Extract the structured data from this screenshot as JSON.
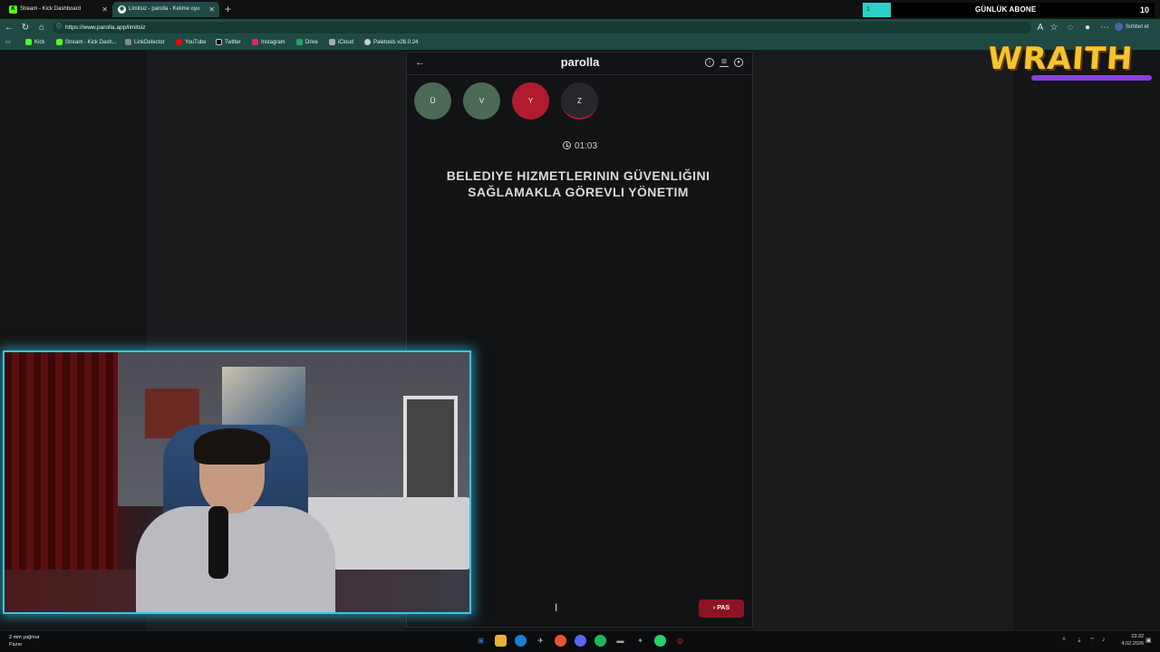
{
  "browser": {
    "tabs": [
      {
        "title": "Stream - Kick Dashboard",
        "favicon": "kick-icon",
        "active": false
      },
      {
        "title": "Limitsiz - parolla - Kelime oyu",
        "favicon": "parolla-icon",
        "active": true
      }
    ],
    "new_tab_label": "+",
    "url": "https://www.parolla.app/limitsiz",
    "chat_label": "Sohbet et",
    "bookmarks": [
      {
        "label": "Kick",
        "color": "#53fc18"
      },
      {
        "label": "Stream - Kick Dash...",
        "color": "#53fc18"
      },
      {
        "label": "LinkDetector",
        "color": "#888888"
      },
      {
        "label": "YouTube",
        "color": "#ff0000"
      },
      {
        "label": "Twitter",
        "color": "#000000"
      },
      {
        "label": "Instagram",
        "color": "#d62976"
      },
      {
        "label": "Drive",
        "color": "#1fa463"
      },
      {
        "label": "iCloud",
        "color": "#aaaaaa"
      },
      {
        "label": "Paletools v26.0.24",
        "color": "#cccccc"
      }
    ]
  },
  "overlay": {
    "sub_count": "1",
    "sub_label": "GÜNLÜK ABONE",
    "sub_total": "10",
    "logo_text": "WRAITH"
  },
  "game": {
    "title": "parolla",
    "back_icon": "arrow-left-icon",
    "header_icons": [
      "info-icon",
      "stats-icon",
      "settings-icon"
    ],
    "letters": [
      {
        "char": "Ü",
        "state": "correct",
        "color": "#4b6a55"
      },
      {
        "char": "V",
        "state": "correct",
        "color": "#4b6a55"
      },
      {
        "char": "Y",
        "state": "wrong",
        "color": "#b01c2e"
      },
      {
        "char": "Z",
        "state": "current",
        "color": "#26272a"
      }
    ],
    "timer": "01:03",
    "question": "BELEDIYE HIZMETLERININ GÜVENLIĞINI SAĞLAMAKLA GÖREVLI YÖNETIM",
    "pass_label": "PAS"
  },
  "taskbar": {
    "weather_line1": "2 mm yağmur",
    "weather_line2": "Pazar",
    "time": "23:32",
    "date": "4.02.2026"
  }
}
